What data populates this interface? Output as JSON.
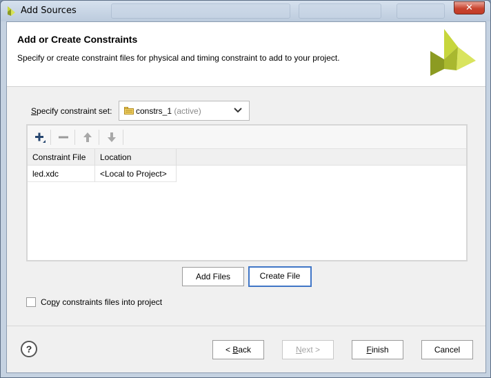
{
  "window": {
    "title": "Add Sources",
    "close_glyph": "✕"
  },
  "header": {
    "title": "Add or Create Constraints",
    "description": "Specify or create constraint files for physical and timing constraint to add to your project.",
    "logo_icon": "vivado-logo-icon"
  },
  "constraint_set": {
    "label_mnemonic": "S",
    "label_rest": "pecify constraint set:",
    "value": "constrs_1",
    "status": "(active)"
  },
  "toolbar": {
    "add_icon": "plus-icon",
    "remove_icon": "minus-icon",
    "move_up_icon": "arrow-up-icon",
    "move_down_icon": "arrow-down-icon"
  },
  "table": {
    "columns": [
      "Constraint File",
      "Location"
    ],
    "rows": [
      {
        "file": "led.xdc",
        "location": "<Local to Project>"
      }
    ]
  },
  "actions": {
    "add_files": "Add Files",
    "create_file": "Create File"
  },
  "copy_option": {
    "pre": "Co",
    "mnemonic": "p",
    "post": "y constraints files into project",
    "checked": false
  },
  "footer": {
    "help": "?",
    "back_arrow": "< ",
    "back_mnemonic": "B",
    "back_rest": "ack",
    "next_mnemonic": "N",
    "next_rest": "ext >",
    "finish_mnemonic": "F",
    "finish_rest": "inish",
    "cancel": "Cancel"
  },
  "colors": {
    "accent": "#3f75c6",
    "logo_green": "#c7d63c",
    "logo_olive": "#8c9b22"
  }
}
